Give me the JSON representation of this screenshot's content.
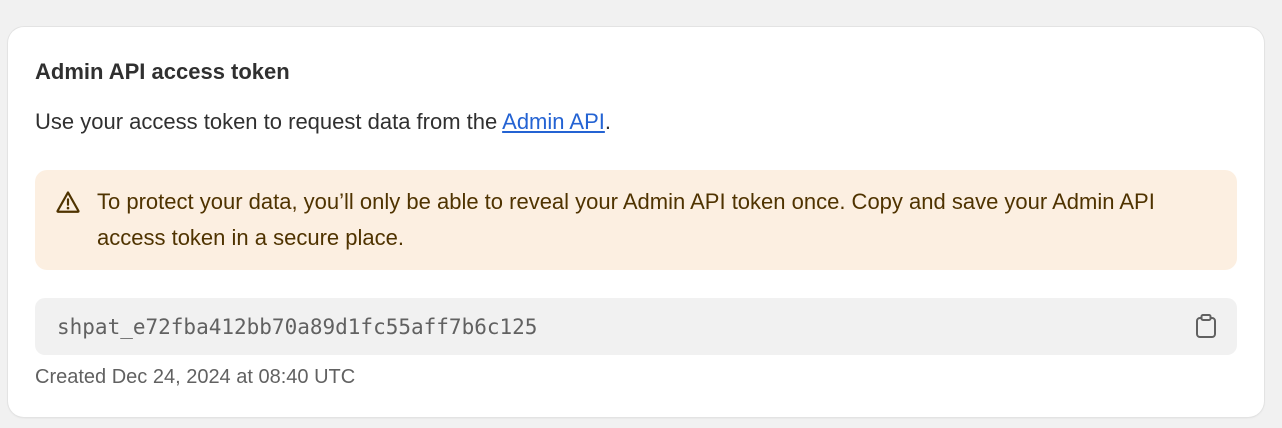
{
  "card": {
    "title": "Admin API access token",
    "description_prefix": "Use your access token to request data from the ",
    "description_link": "Admin API",
    "description_suffix": ".",
    "warning": {
      "icon": "alert-triangle-icon",
      "text": "To protect your data, you’ll only be able to reveal your Admin API token once. Copy and save your Admin API access token in a secure place."
    },
    "token": {
      "value": "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",
      "copy_icon": "clipboard-icon"
    },
    "created": "Created Dec 24, 2024 at 08:40 UTC"
  },
  "colors": {
    "link": "#2463d3",
    "warning_bg": "#fcefe1",
    "warning_text": "#4f3300",
    "token_bg": "#f1f1f1"
  }
}
